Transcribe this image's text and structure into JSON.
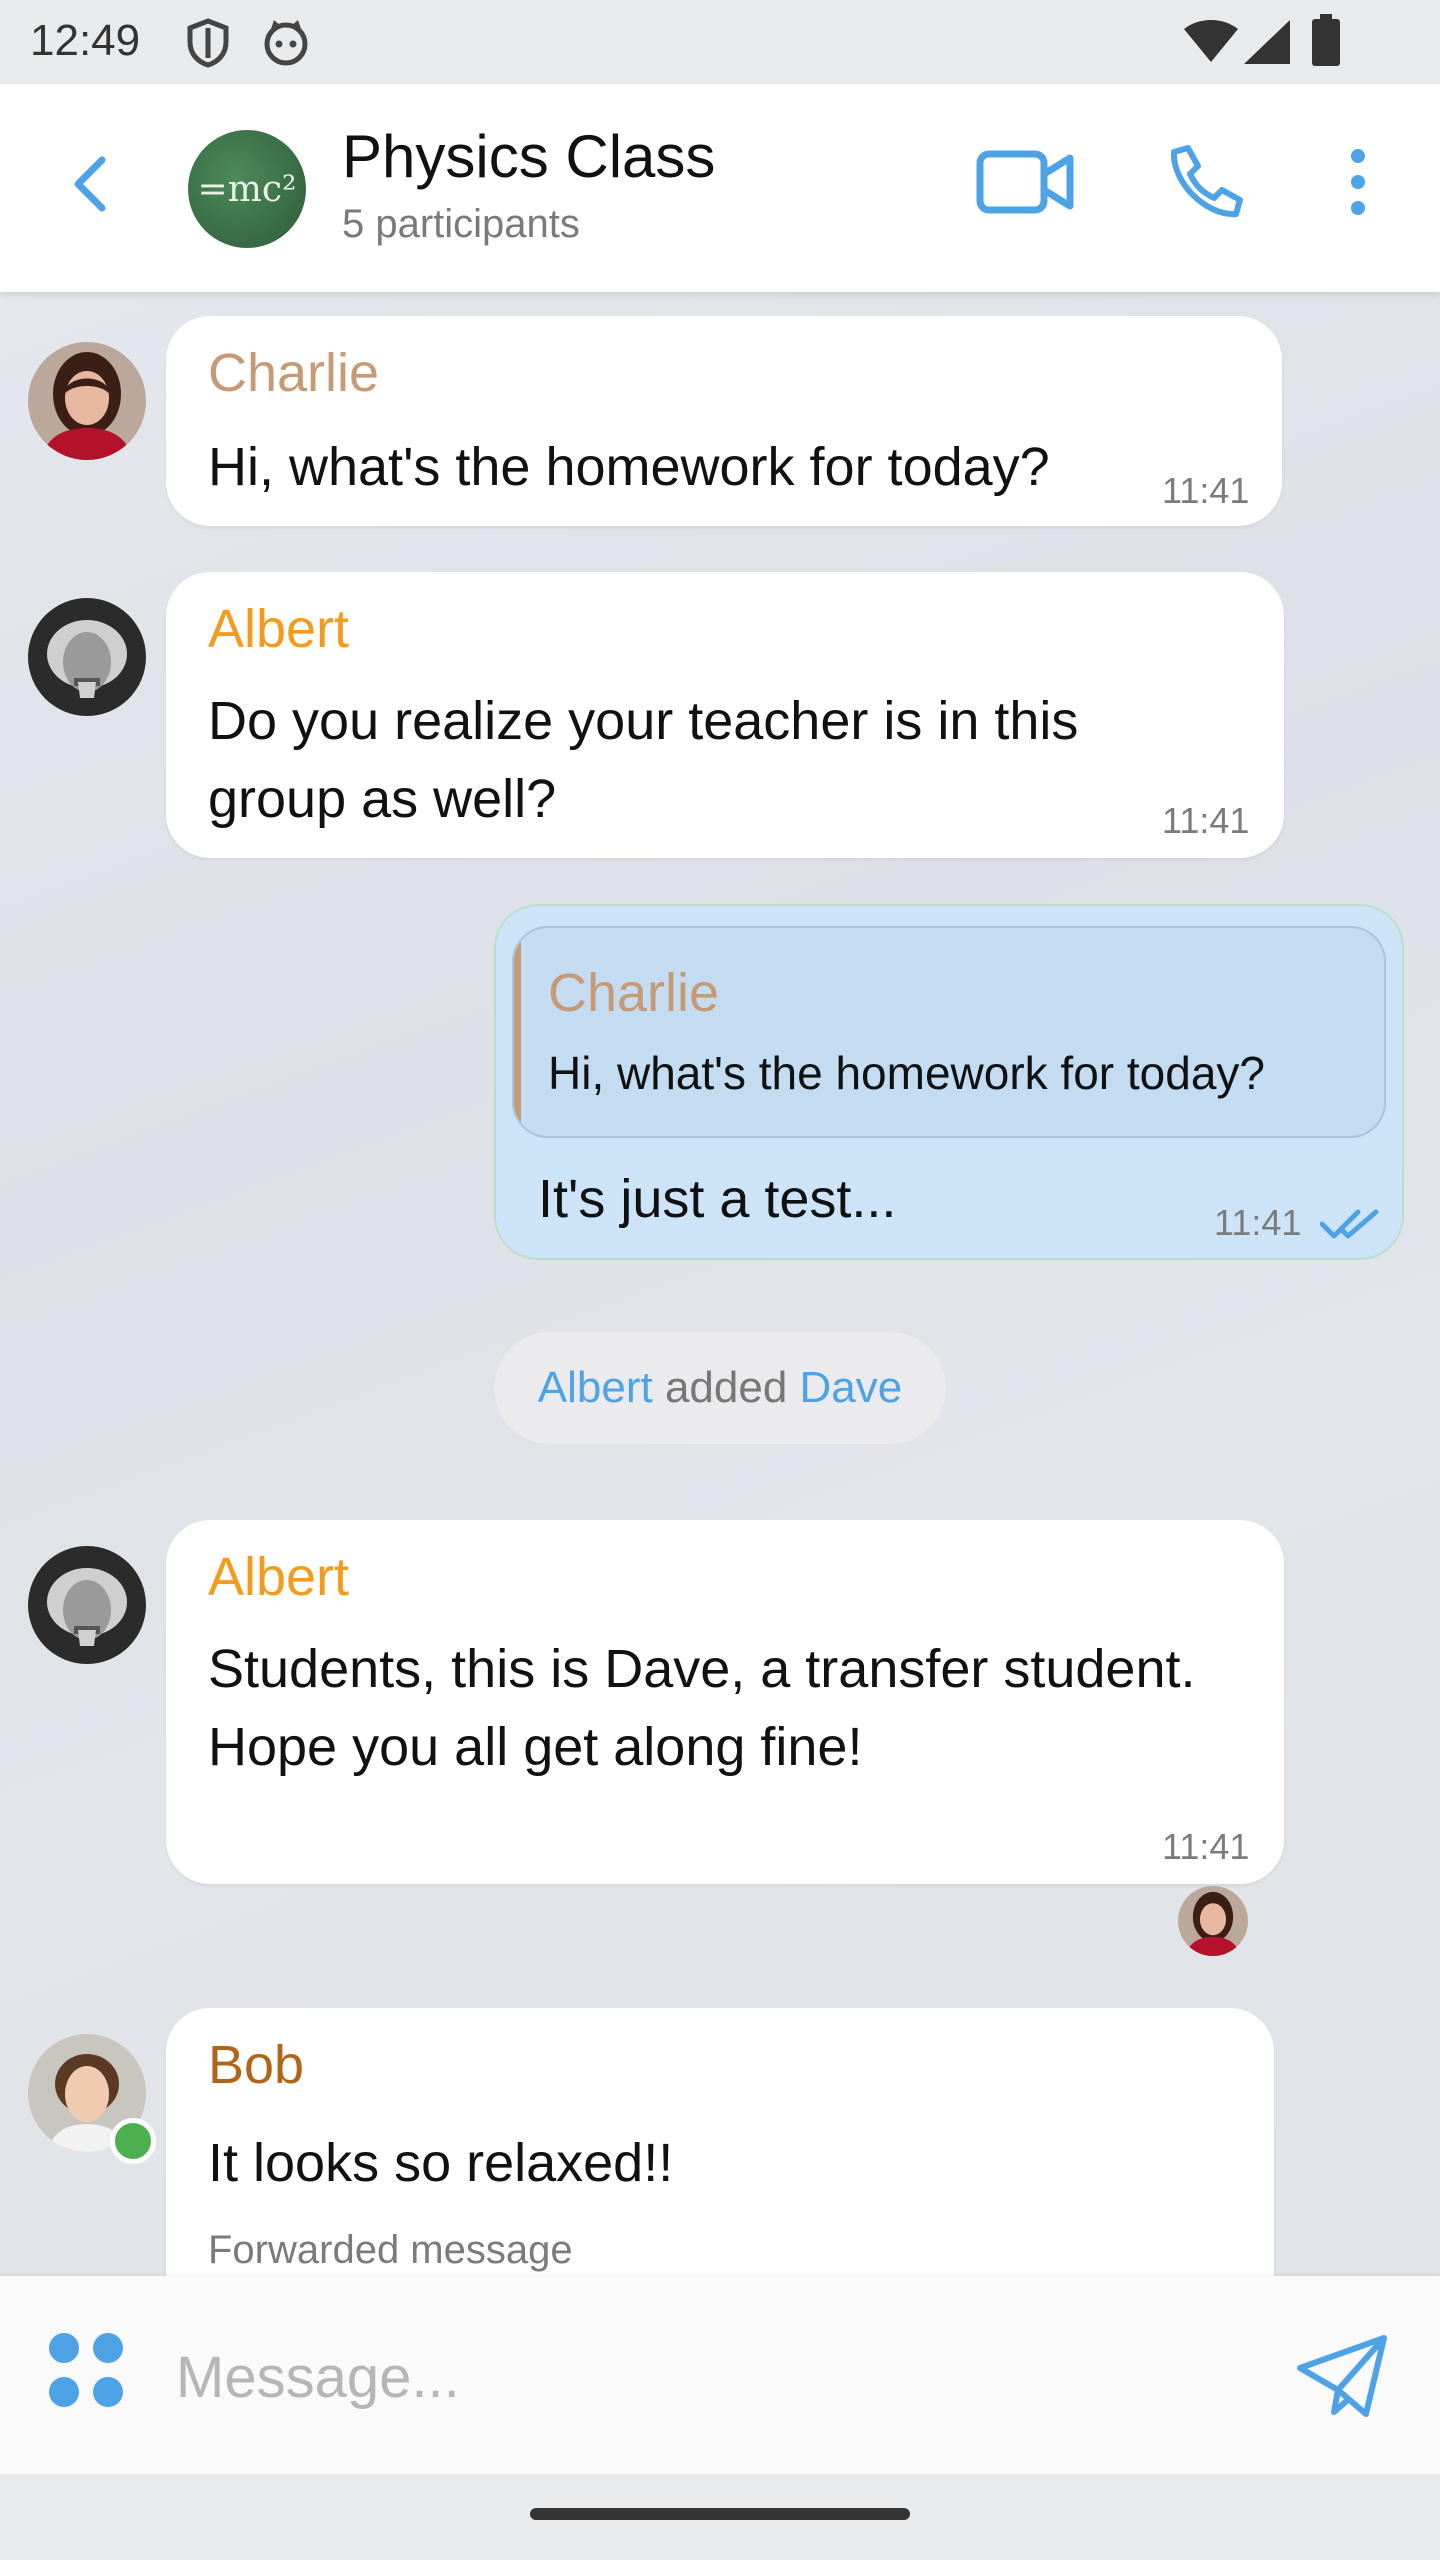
{
  "status_bar": {
    "time": "12:49"
  },
  "header": {
    "title": "Physics Class",
    "subtitle": "5 participants",
    "avatar_text": "=mc²"
  },
  "messages": [
    {
      "sender": "Charlie",
      "sender_color": "#c79a76",
      "text": "Hi, what's the homework for today?",
      "time": "11:41"
    },
    {
      "sender": "Albert",
      "sender_color": "#f29b1c",
      "text": "Do you realize your teacher is in this group as well?",
      "time": "11:41"
    },
    {
      "own": true,
      "reply_sender": "Charlie",
      "reply_text": "Hi, what's the homework for today?",
      "text": "It's just a test...",
      "time": "11:41",
      "status": "read"
    },
    {
      "system": true,
      "actor": "Albert",
      "action": "added",
      "target": "Dave"
    },
    {
      "sender": "Albert",
      "sender_color": "#f29b1c",
      "text": "Students, this is Dave, a transfer student. Hope you all get along fine!",
      "time": "11:41"
    },
    {
      "sender": "Bob",
      "sender_color": "#b0651b",
      "text": "It looks so relaxed!!",
      "note": "Forwarded message",
      "online": true
    }
  ],
  "composer": {
    "placeholder": "Message..."
  },
  "colors": {
    "accent": "#4ea3e6",
    "own_bubble": "#cde4f8",
    "online": "#4caf50"
  }
}
